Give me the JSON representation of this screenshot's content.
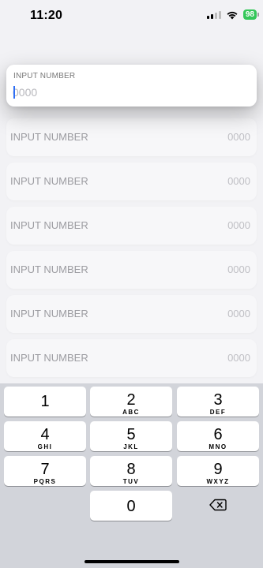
{
  "status": {
    "time": "11:20",
    "battery": "98"
  },
  "focused_field": {
    "label": "INPUT NUMBER",
    "placeholder": "0000"
  },
  "rows": [
    {
      "label": "INPUT NUMBER",
      "value": "0000"
    },
    {
      "label": "INPUT NUMBER",
      "value": "0000"
    },
    {
      "label": "INPUT NUMBER",
      "value": "0000"
    },
    {
      "label": "INPUT NUMBER",
      "value": "0000"
    },
    {
      "label": "INPUT NUMBER",
      "value": "0000"
    },
    {
      "label": "INPUT NUMBER",
      "value": "0000"
    }
  ],
  "keypad": [
    {
      "num": "1",
      "letters": ""
    },
    {
      "num": "2",
      "letters": "ABC"
    },
    {
      "num": "3",
      "letters": "DEF"
    },
    {
      "num": "4",
      "letters": "GHI"
    },
    {
      "num": "5",
      "letters": "JKL"
    },
    {
      "num": "6",
      "letters": "MNO"
    },
    {
      "num": "7",
      "letters": "PQRS"
    },
    {
      "num": "8",
      "letters": "TUV"
    },
    {
      "num": "9",
      "letters": "WXYZ"
    },
    {
      "num": "0",
      "letters": ""
    }
  ],
  "icons": {
    "signal": "signal-icon",
    "wifi": "wifi-icon",
    "battery": "battery-icon",
    "delete": "delete-icon"
  },
  "colors": {
    "accent": "#2e6ef5",
    "battery": "#34c759",
    "keyboard_bg": "#d2d4da"
  }
}
